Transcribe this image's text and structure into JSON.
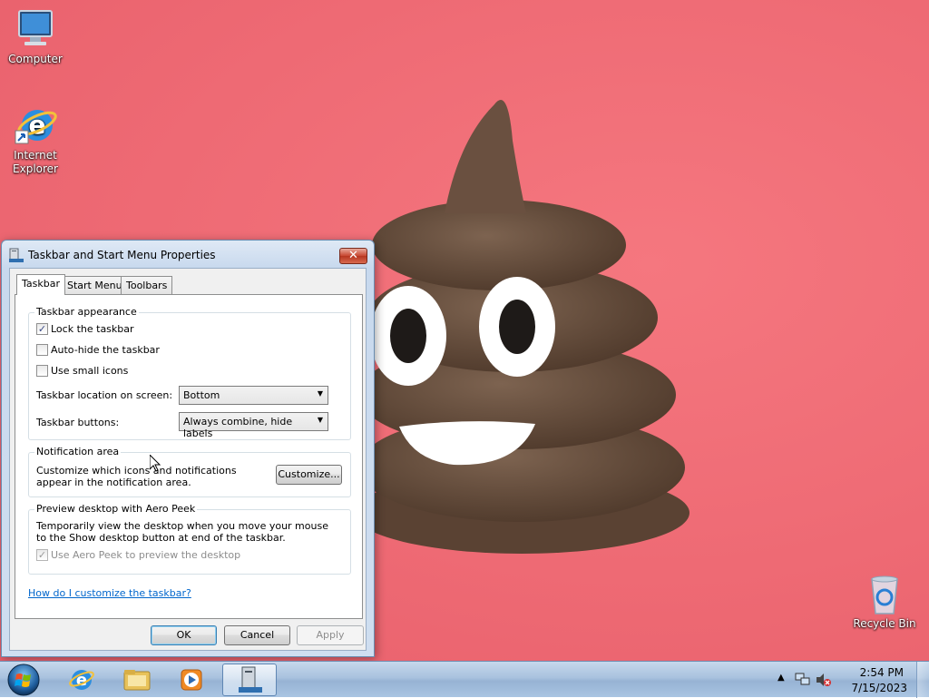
{
  "desktop": {
    "icons": [
      {
        "label": "Computer"
      },
      {
        "label": "Internet Explorer"
      },
      {
        "label": "Recycle Bin"
      }
    ]
  },
  "dialog": {
    "title": "Taskbar and Start Menu Properties",
    "close_label": "✕",
    "tabs": [
      {
        "label": "Taskbar",
        "active": true
      },
      {
        "label": "Start Menu",
        "active": false
      },
      {
        "label": "Toolbars",
        "active": false
      }
    ],
    "appearance": {
      "title": "Taskbar appearance",
      "lock": {
        "label": "Lock the taskbar",
        "checked": true
      },
      "autohide": {
        "label": "Auto-hide the taskbar",
        "checked": false
      },
      "small_icons": {
        "label": "Use small icons",
        "checked": false
      },
      "location_label": "Taskbar location on screen:",
      "location_value": "Bottom",
      "buttons_label": "Taskbar buttons:",
      "buttons_value": "Always combine, hide labels"
    },
    "notification": {
      "title": "Notification area",
      "text": "Customize which icons and notifications appear in the notification area.",
      "customize_label": "Customize..."
    },
    "aero_peek": {
      "title": "Preview desktop with Aero Peek",
      "text": "Temporarily view the desktop when you move your mouse to the Show desktop button at end of the taskbar.",
      "checkbox": {
        "label": "Use Aero Peek to preview the desktop",
        "checked": true,
        "disabled": true
      }
    },
    "help_link": "How do I customize the taskbar?",
    "buttons": {
      "ok": "OK",
      "cancel": "Cancel",
      "apply": "Apply"
    }
  },
  "taskbar": {
    "items": [
      "start-orb",
      "internet-explorer",
      "windows-explorer",
      "media-player",
      "taskbar-properties"
    ],
    "clock": {
      "time": "2:54 PM",
      "date": "7/15/2023"
    }
  }
}
